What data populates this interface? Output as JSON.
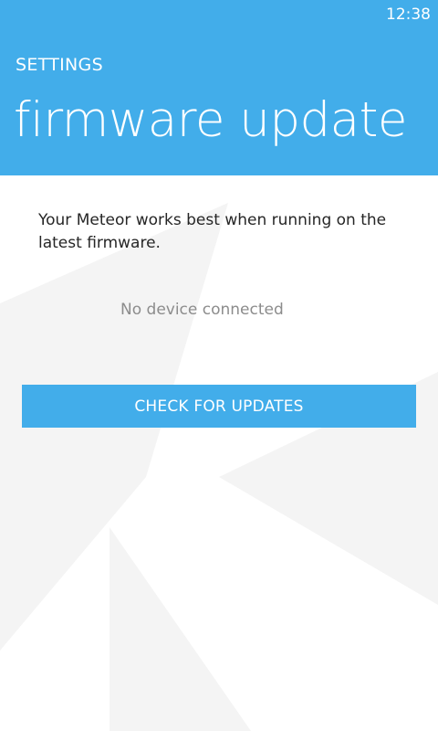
{
  "status_bar": {
    "time": "12:38"
  },
  "header": {
    "app_title": "SETTINGS",
    "page_title": "firmware update"
  },
  "main": {
    "description": "Your Meteor works best when running on the latest firmware.",
    "connection_status": "No device connected",
    "check_button_label": "CHECK FOR UPDATES"
  },
  "colors": {
    "accent": "#42adea",
    "background": "#ffffff",
    "text_primary": "#262626",
    "text_secondary": "#8c8c8c",
    "watermark": "#f4f4f4"
  }
}
